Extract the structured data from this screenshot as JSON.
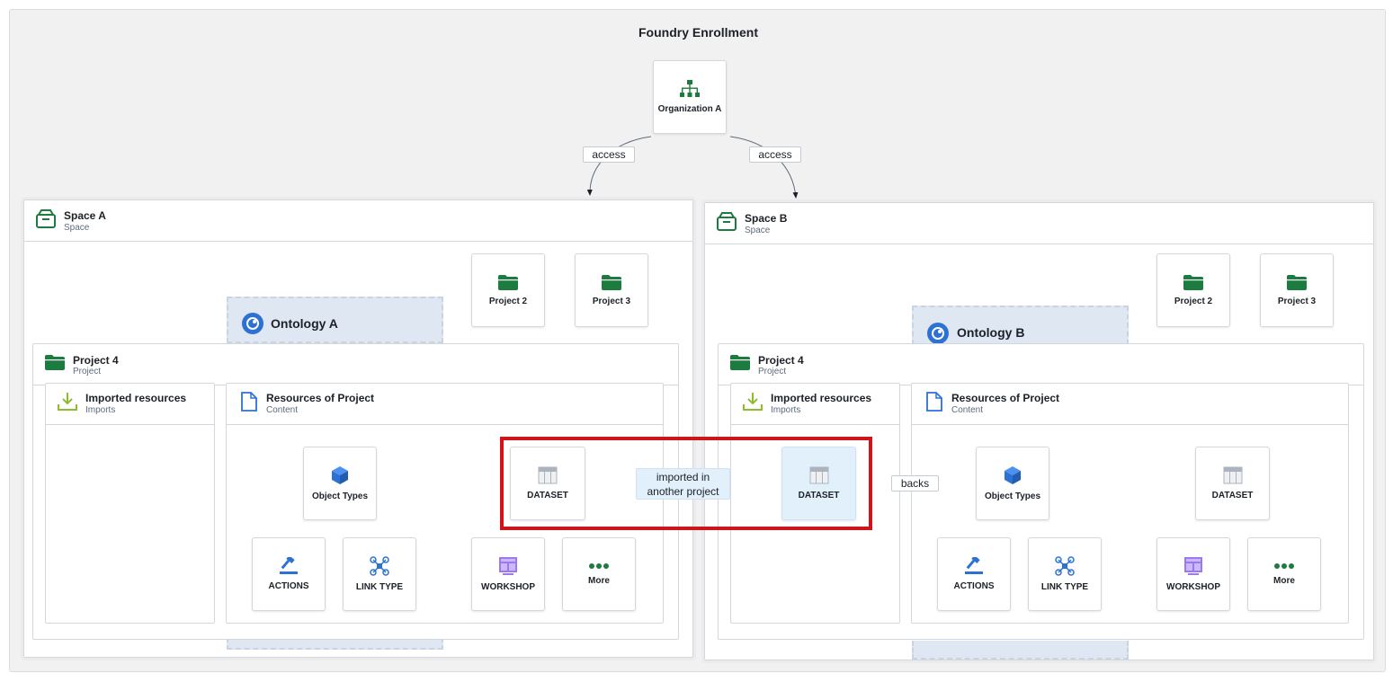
{
  "title": "Foundry Enrollment",
  "colors": {
    "green": "#1c7b3e",
    "blue": "#2d72d2",
    "purple": "#9c79f0",
    "lime": "#8fbc2c",
    "highlight": "#d0141c",
    "ontology_bg": "#dfe7f3"
  },
  "organization": {
    "label": "Organization A",
    "icon": "org-chart-icon"
  },
  "edges": {
    "access_left": "access",
    "access_right": "access",
    "imported": "imported in another project",
    "backs": "backs"
  },
  "space_a": {
    "title": "Space A",
    "subtitle": "Space",
    "icon": "space-icon",
    "project2": "Project 2",
    "project3": "Project 3",
    "ontology": "Ontology A",
    "project4": {
      "title": "Project 4",
      "subtitle": "Project"
    },
    "imports": {
      "title": "Imported resources",
      "subtitle": "Imports"
    },
    "resources": {
      "title": "Resources of Project",
      "subtitle": "Content"
    },
    "tiles": {
      "object_types": "Object Types",
      "dataset": "DATASET",
      "actions": "ACTIONS",
      "link_type": "LINK TYPE",
      "workshop": "WORKSHOP",
      "more": "More"
    }
  },
  "space_b": {
    "title": "Space B",
    "subtitle": "Space",
    "icon": "space-icon",
    "project2": "Project 2",
    "project3": "Project 3",
    "ontology": "Ontology B",
    "project4": {
      "title": "Project 4",
      "subtitle": "Project"
    },
    "imports": {
      "title": "Imported resources",
      "subtitle": "Imports"
    },
    "imported_dataset": "DATASET",
    "resources": {
      "title": "Resources of Project",
      "subtitle": "Content"
    },
    "tiles": {
      "object_types": "Object Types",
      "dataset": "DATASET",
      "actions": "ACTIONS",
      "link_type": "LINK TYPE",
      "workshop": "WORKSHOP",
      "more": "More"
    }
  }
}
